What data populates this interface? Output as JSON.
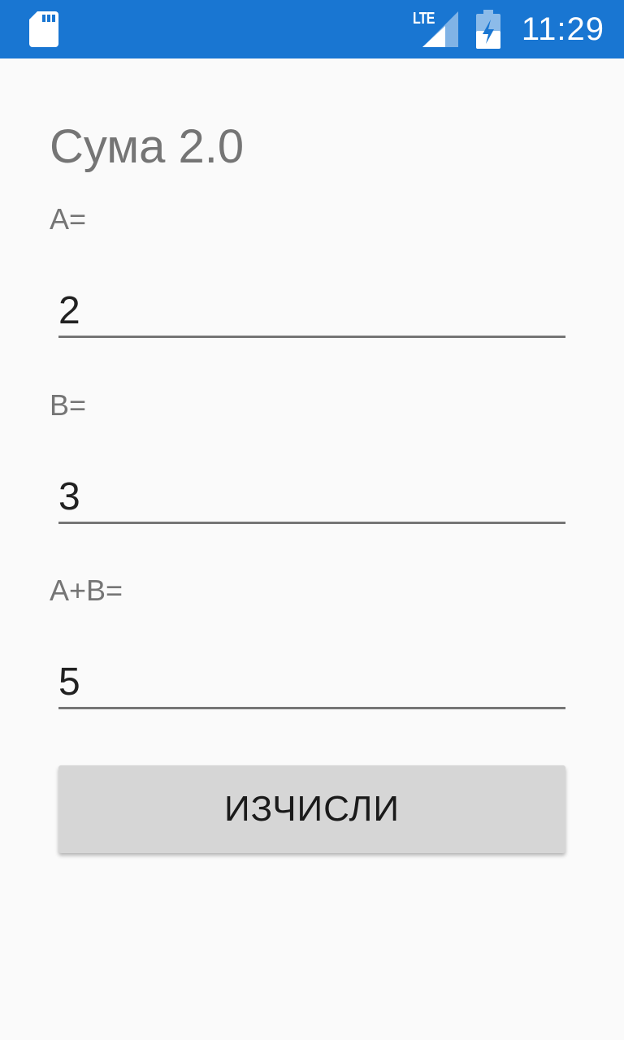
{
  "status_bar": {
    "network_label": "LTE",
    "time": "11:29",
    "icons": [
      "sd-card-icon",
      "lte-signal-icon",
      "battery-charging-icon"
    ],
    "background_color": "#1976d2"
  },
  "app": {
    "title": "Сума 2.0"
  },
  "fields": {
    "a": {
      "label": "A=",
      "value": "2"
    },
    "b": {
      "label": "B=",
      "value": "3"
    },
    "sum": {
      "label": "A+B=",
      "value": "5"
    }
  },
  "calculate_button": {
    "label": "ИЗЧИСЛИ"
  }
}
